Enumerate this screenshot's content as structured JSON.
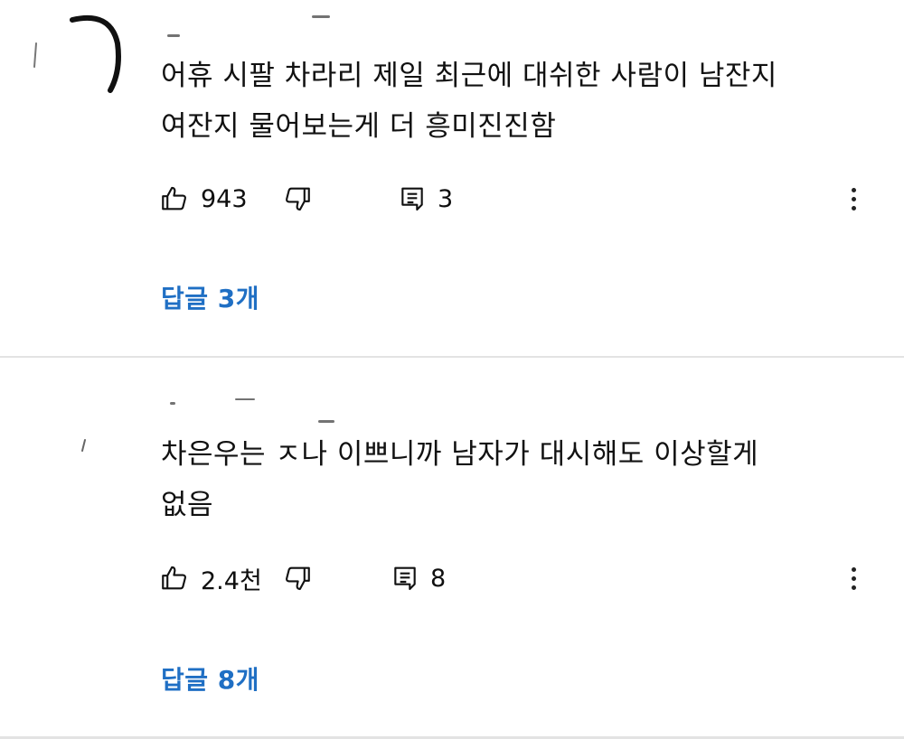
{
  "comments": [
    {
      "text_lines": [
        "어휴 시팔 차라리 제일 최근에 대쉬한 사람이 남잔지",
        "여잔지 물어보는게 더 흥미진진함"
      ],
      "likes": "943",
      "reply_count": "3",
      "replies_link": "답글 3개",
      "like_icon": "thumbs-up-icon",
      "dislike_icon": "thumbs-down-icon",
      "reply_icon": "comment-icon",
      "more_icon": "more-vert-icon"
    },
    {
      "text_lines": [
        "차은우는 ㅈ나 이쁘니까 남자가 대시해도 이상할게",
        "없음"
      ],
      "likes": "2.4천",
      "reply_count": "8",
      "replies_link": "답글 8개",
      "like_icon": "thumbs-up-icon",
      "dislike_icon": "thumbs-down-icon",
      "reply_icon": "comment-icon",
      "more_icon": "more-vert-icon"
    }
  ],
  "colors": {
    "link": "#1f6fc4",
    "divider": "#e3e3e3",
    "text": "#111111"
  }
}
